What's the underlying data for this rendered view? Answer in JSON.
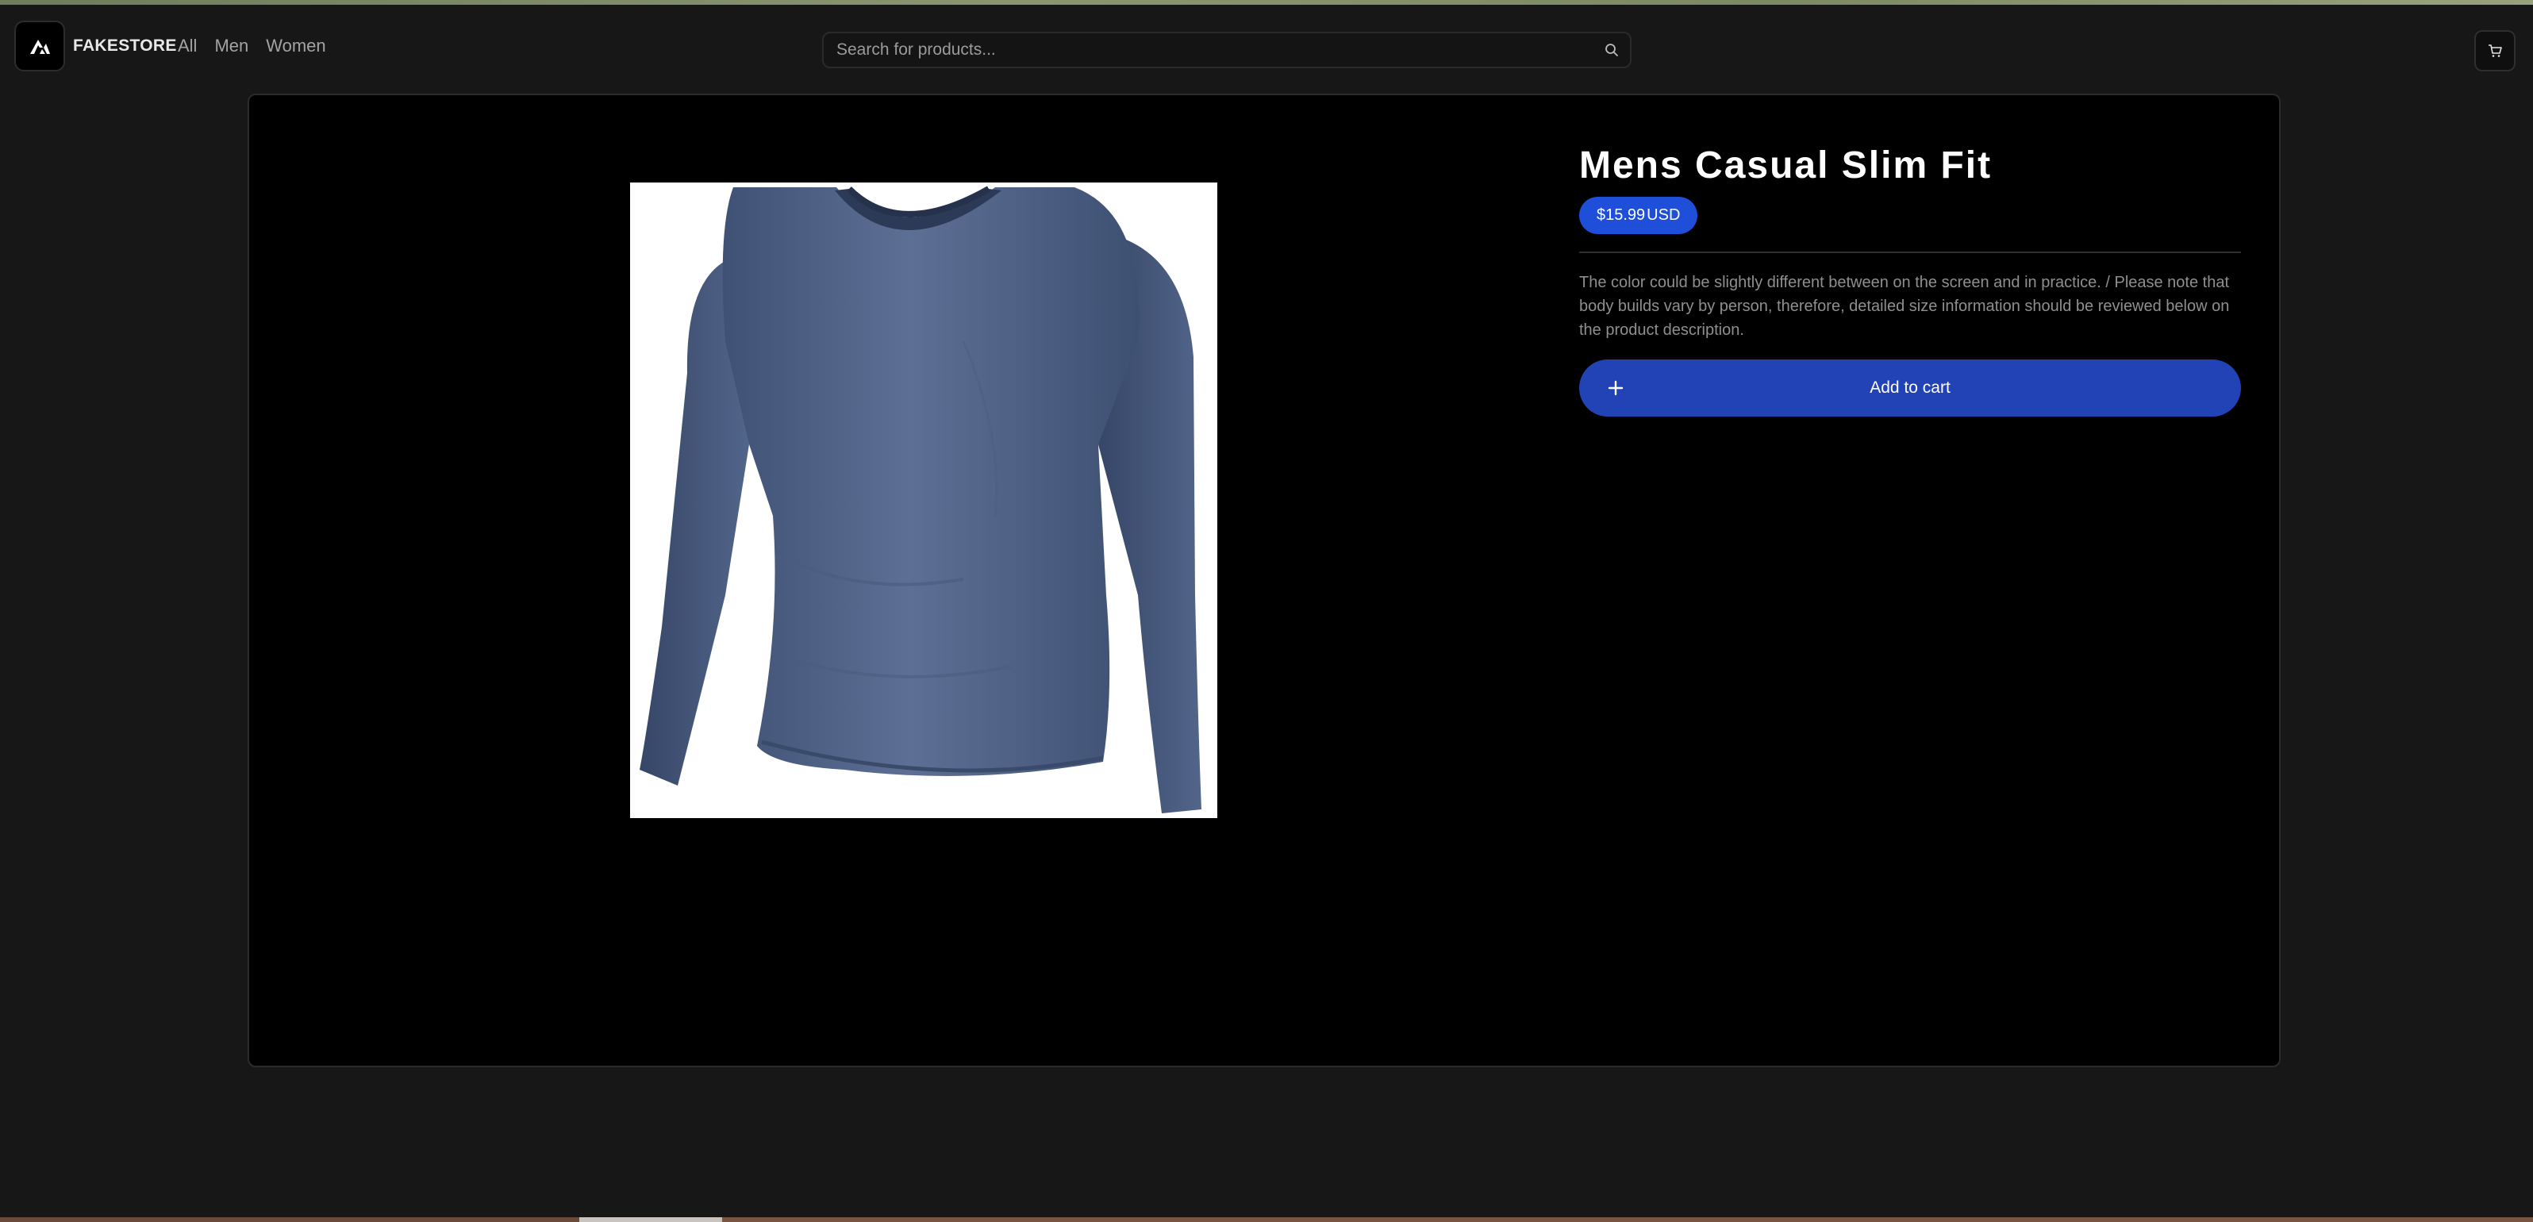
{
  "navbar": {
    "brand": "FAKESTORE",
    "links": [
      {
        "label": "All"
      },
      {
        "label": "Men"
      },
      {
        "label": "Women"
      }
    ],
    "search": {
      "placeholder": "Search for products...",
      "value": ""
    }
  },
  "product": {
    "title": "Mens Casual Slim Fit",
    "price": "$15.99",
    "currency": "USD",
    "description": "The color could be slightly different between on the screen and in practice. / Please note that body builds vary by person, therefore, detailed size information should be reviewed below on the product description.",
    "add_to_cart_label": "Add to cart"
  },
  "icons": {
    "logo": "triangle-logo-icon",
    "search": "search-icon",
    "cart": "cart-icon",
    "add": "plus-icon"
  },
  "colors": {
    "page_bg": "#171717",
    "card_bg": "#000000",
    "accent": "#2143b5",
    "price_pill": "#1f4fd8"
  }
}
